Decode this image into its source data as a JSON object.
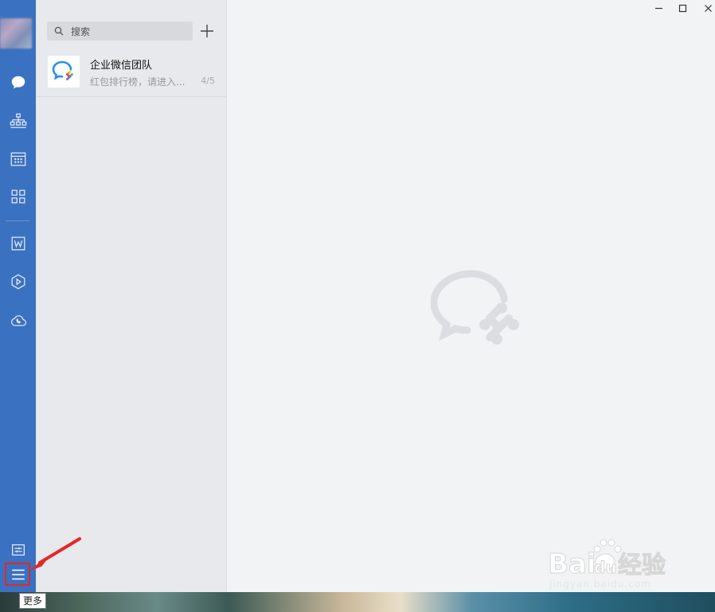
{
  "search": {
    "placeholder": "搜索"
  },
  "conversations": [
    {
      "name": "企业微信团队",
      "preview": "红包排行榜，请进入...",
      "time": "4/5"
    }
  ],
  "tooltip": {
    "more": "更多"
  },
  "nav_icons": [
    "message-icon",
    "org-chart-icon",
    "calendar-icon",
    "apps-grid-icon",
    "document-icon",
    "workbench-icon",
    "cloud-phone-icon",
    "settings-sliders-icon",
    "menu-icon"
  ],
  "colors": {
    "nav_bg": "#3b71c1",
    "highlight": "#e02828",
    "list_bg": "#e8e9ec",
    "main_bg": "#f2f3f5"
  },
  "watermark": {
    "brand": "Bai",
    "brand2": "du",
    "suffix": "经验",
    "url": "jingyan.baidu.com"
  }
}
